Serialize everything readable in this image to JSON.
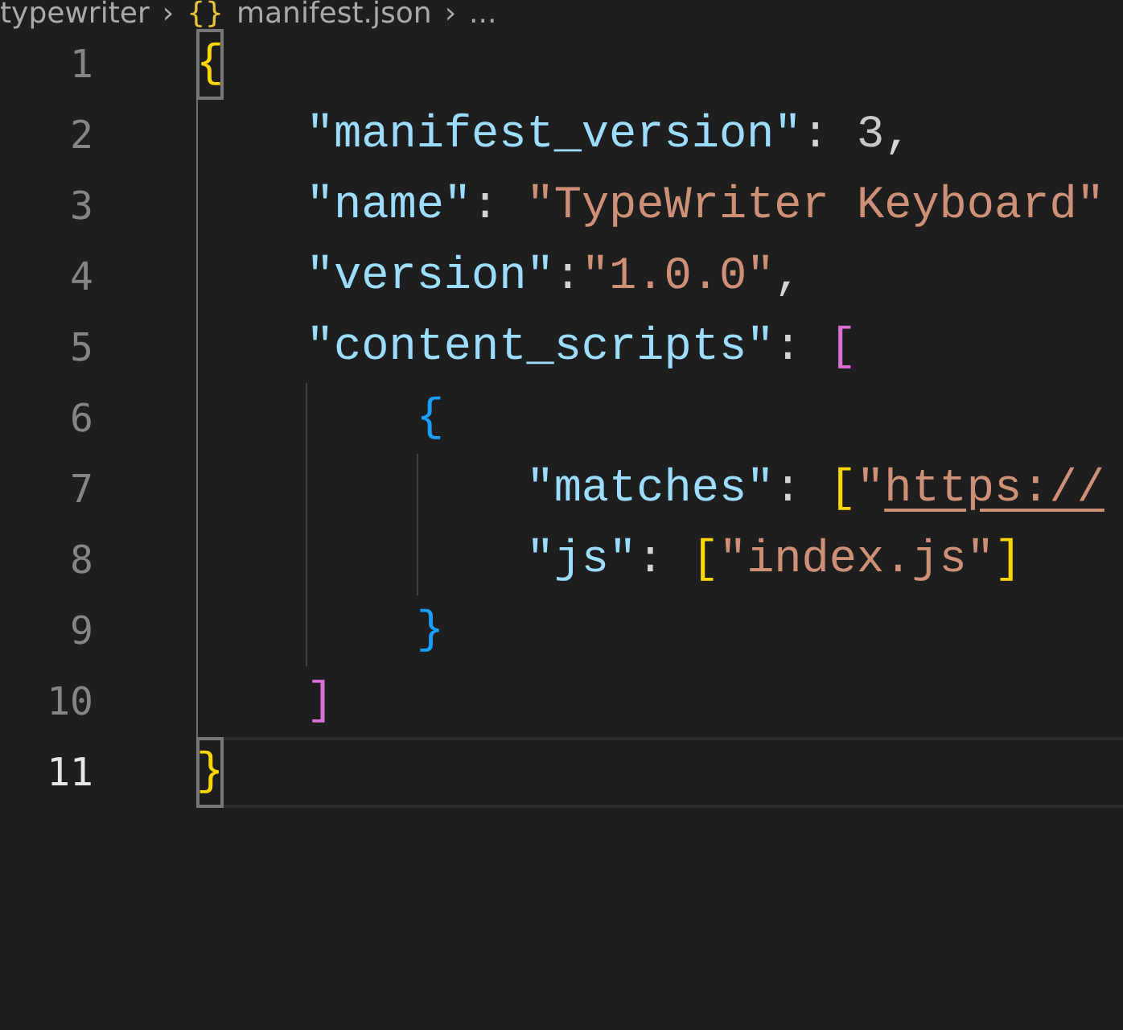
{
  "breadcrumb": {
    "separator": "›",
    "items": [
      {
        "text": "typewriter"
      },
      {
        "icon": "{}",
        "text": "manifest.json"
      },
      {
        "text": "..."
      }
    ]
  },
  "editor": {
    "lines": [
      {
        "number": "1",
        "current": false,
        "tokens": [
          {
            "text": "{",
            "kind": "bracket1",
            "matched": true
          }
        ],
        "children": [
          {
            "number": "2",
            "current": false,
            "tokens": [
              {
                "text": "\"manifest_version\"",
                "kind": "key"
              },
              {
                "text": ": ",
                "kind": "punct"
              },
              {
                "text": "3",
                "kind": "number"
              },
              {
                "text": ",",
                "kind": "punct"
              }
            ]
          },
          {
            "number": "3",
            "current": false,
            "tokens": [
              {
                "text": "\"name\"",
                "kind": "key"
              },
              {
                "text": ": ",
                "kind": "punct"
              },
              {
                "text": "\"TypeWriter Keyboard\"",
                "kind": "string"
              }
            ]
          },
          {
            "number": "4",
            "current": false,
            "tokens": [
              {
                "text": "\"version\"",
                "kind": "key"
              },
              {
                "text": ":",
                "kind": "punct"
              },
              {
                "text": "\"1.0.0\"",
                "kind": "string"
              },
              {
                "text": ",",
                "kind": "punct"
              }
            ]
          },
          {
            "number": "5",
            "current": false,
            "tokens": [
              {
                "text": "\"content_scripts\"",
                "kind": "key"
              },
              {
                "text": ": ",
                "kind": "punct"
              },
              {
                "text": "[",
                "kind": "bracket2"
              }
            ],
            "children": [
              {
                "number": "6",
                "current": false,
                "tokens": [
                  {
                    "text": "{",
                    "kind": "bracket3"
                  }
                ],
                "children": [
                  {
                    "number": "7",
                    "current": false,
                    "tokens": [
                      {
                        "text": "\"matches\"",
                        "kind": "key"
                      },
                      {
                        "text": ": ",
                        "kind": "punct"
                      },
                      {
                        "text": "[",
                        "kind": "bracket1"
                      },
                      {
                        "text": "\"",
                        "kind": "string"
                      },
                      {
                        "text": "https://",
                        "kind": "link"
                      }
                    ]
                  },
                  {
                    "number": "8",
                    "current": false,
                    "tokens": [
                      {
                        "text": "\"js\"",
                        "kind": "key"
                      },
                      {
                        "text": ": ",
                        "kind": "punct"
                      },
                      {
                        "text": "[",
                        "kind": "bracket1"
                      },
                      {
                        "text": "\"index.js\"",
                        "kind": "string"
                      },
                      {
                        "text": "]",
                        "kind": "bracket1"
                      }
                    ]
                  }
                ]
              },
              {
                "number": "9",
                "current": false,
                "tokens": [
                  {
                    "text": "}",
                    "kind": "bracket3"
                  }
                ]
              }
            ]
          },
          {
            "number": "10",
            "current": false,
            "tokens": [
              {
                "text": "]",
                "kind": "bracket2"
              }
            ]
          }
        ]
      },
      {
        "number": "11",
        "current": true,
        "tokens": [
          {
            "text": "}",
            "kind": "bracket1",
            "matched": true
          }
        ]
      }
    ]
  }
}
